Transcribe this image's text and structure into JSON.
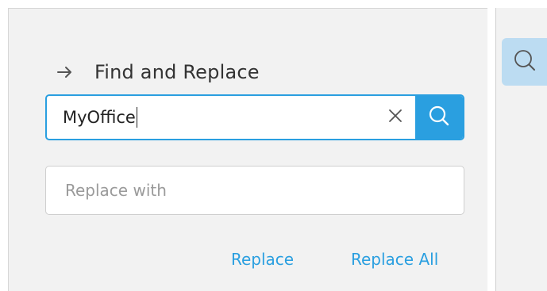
{
  "panel": {
    "title": "Find and Replace",
    "back_icon": "arrow-right-icon"
  },
  "find": {
    "value": "MyOffice",
    "clear_icon": "close-icon",
    "search_icon": "search-icon"
  },
  "replace": {
    "value": "",
    "placeholder": "Replace with"
  },
  "actions": {
    "replace_label": "Replace",
    "replace_all_label": "Replace All"
  },
  "sidebar": {
    "search_icon": "search-icon"
  },
  "colors": {
    "accent": "#2a9fe0",
    "panel_bg": "#f2f2f2",
    "side_button_bg": "#bcdcf2"
  }
}
